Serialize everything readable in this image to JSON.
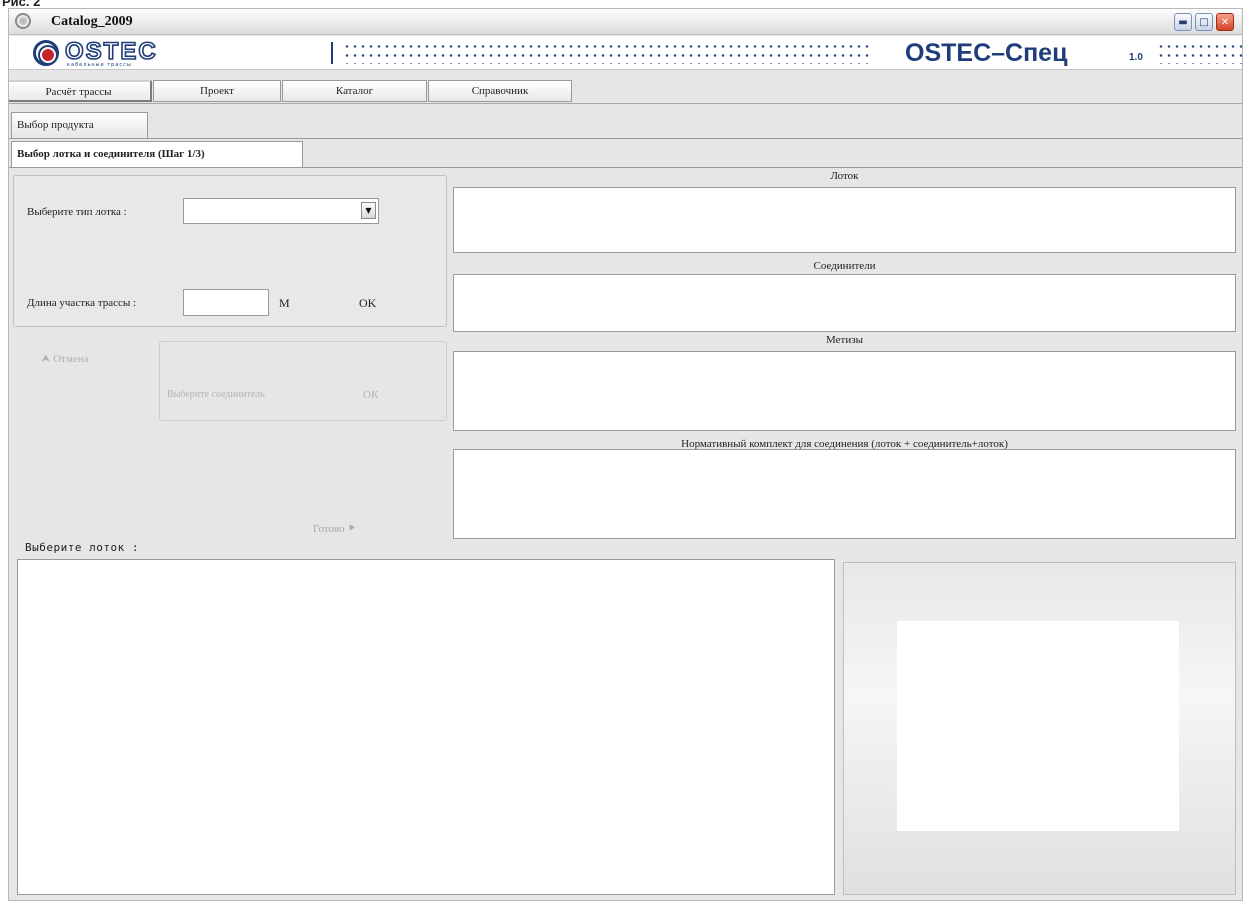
{
  "caption": "Рис. 2",
  "window": {
    "title": "Catalog_2009",
    "minimize_glyph": "▬",
    "maximize_glyph": "□",
    "close_glyph": "✕"
  },
  "banner": {
    "logo_text": "OSTEC",
    "logo_subtitle": "кабельные трассы",
    "product_title": "OSTEC–Спец",
    "product_version": "1.0",
    "brand_color": "#1f3d7a",
    "logo_accent_color": "#c8232c"
  },
  "tabs": [
    {
      "label": "Расчёт трассы"
    },
    {
      "label": "Проект"
    },
    {
      "label": "Каталог"
    },
    {
      "label": "Справочник"
    }
  ],
  "subtab": {
    "label": "Выбор продукта"
  },
  "step_tab": {
    "label": "Выбор лотка и соединителя (Шаг 1/3)"
  },
  "form": {
    "tray_type_label": "Выберите тип лотка :",
    "tray_type_value": "",
    "dropdown_glyph": "▼",
    "length_label": "Длина участка трассы :",
    "length_value": "",
    "length_unit": "М",
    "ok_label": "OK",
    "cancel_label": "⮝ Отмена",
    "connector_label": "Выберите соединитель",
    "connector_ok_label": "OK",
    "done_label": "Готово ⯈",
    "select_tray_label": "Выберите лоток :"
  },
  "panels": {
    "tray_caption": "Лоток",
    "connectors_caption": "Соединители",
    "fasteners_caption": "Метизы",
    "norm_caption": "Нормативный комплект для соединения (лоток + соединитель+лоток)"
  }
}
